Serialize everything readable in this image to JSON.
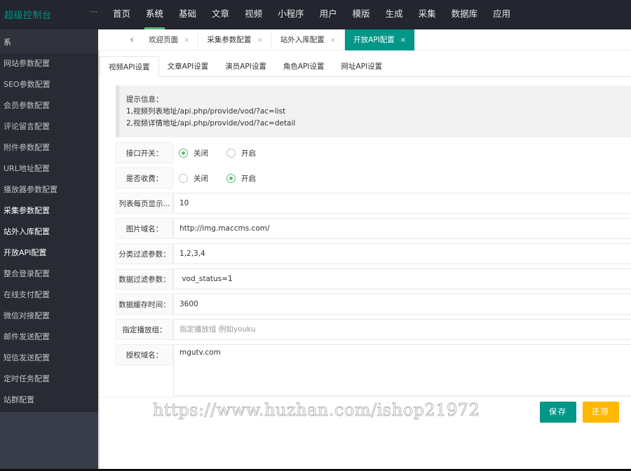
{
  "header": {
    "logo": "超级控制台",
    "toggle_icon": "⋯",
    "nav": [
      "首页",
      "系统",
      "基础",
      "文章",
      "视频",
      "小程序",
      "用户",
      "模版",
      "生成",
      "采集",
      "数据库",
      "应用"
    ],
    "active_nav": "系统"
  },
  "sidebar": {
    "head_label": "系",
    "items": [
      {
        "label": "网站参数配置"
      },
      {
        "label": "SEO参数配置"
      },
      {
        "label": "会员参数配置"
      },
      {
        "label": "评论留言配置"
      },
      {
        "label": "附件参数配置"
      },
      {
        "label": "URL地址配置"
      },
      {
        "label": "播放器参数配置"
      },
      {
        "label": "采集参数配置"
      },
      {
        "label": "站外入库配置"
      },
      {
        "label": "开放API配置"
      },
      {
        "label": "整合登录配置"
      },
      {
        "label": "在线支付配置"
      },
      {
        "label": "微信对接配置"
      },
      {
        "label": "邮件发送配置"
      },
      {
        "label": "短信发送配置"
      },
      {
        "label": "定时任务配置"
      },
      {
        "label": "站群配置"
      }
    ]
  },
  "page_tabs": {
    "prev_icon": "‹",
    "close_icon": "×",
    "tabs": [
      {
        "label": "欢迎页面"
      },
      {
        "label": "采集参数配置"
      },
      {
        "label": "站外入库配置"
      },
      {
        "label": "开放API配置"
      }
    ],
    "active": "开放API配置"
  },
  "sub_tabs": {
    "tabs": [
      "视频API设置",
      "文章API设置",
      "演员API设置",
      "角色API设置",
      "网址API设置"
    ],
    "active": "视频API设置"
  },
  "tip": {
    "title": "提示信息：",
    "line1": "1,视频列表地址/api.php/provide/vod/?ac=list",
    "line2": "2,视频详情地址/api.php/provide/vod/?ac=detail"
  },
  "form": {
    "api_switch": {
      "label": "接口开关：",
      "options": [
        "关闭",
        "开启"
      ],
      "selected": "关闭"
    },
    "charge": {
      "label": "是否收费：",
      "options": [
        "关闭",
        "开启"
      ],
      "selected": "开启"
    },
    "page_size": {
      "label": "列表每页显示...",
      "value": "10"
    },
    "img_domain": {
      "label": "图片域名：",
      "value": "http://img.maccms.com/"
    },
    "type_filter": {
      "label": "分类过滤参数：",
      "value": "1,2,3,4"
    },
    "data_filter": {
      "label": "数据过滤参数：",
      "value": " vod_status=1"
    },
    "cache_time": {
      "label": "数据缓存时间：",
      "value": "3600"
    },
    "play_group": {
      "label": "指定播放组：",
      "value": "",
      "placeholder": "指定播放组 例如youku"
    },
    "auth_domain": {
      "label": "授权域名：",
      "value": "mgutv.com"
    }
  },
  "buttons": {
    "save": "保存",
    "reset": "还原"
  },
  "watermark": "https://www.huzhan.com/ishop21972",
  "colors": {
    "accent": "#009688",
    "warn": "#ffb800",
    "radio": "#5fb878",
    "header_bg": "#23262e",
    "sidebar_bg": "#282b33"
  }
}
